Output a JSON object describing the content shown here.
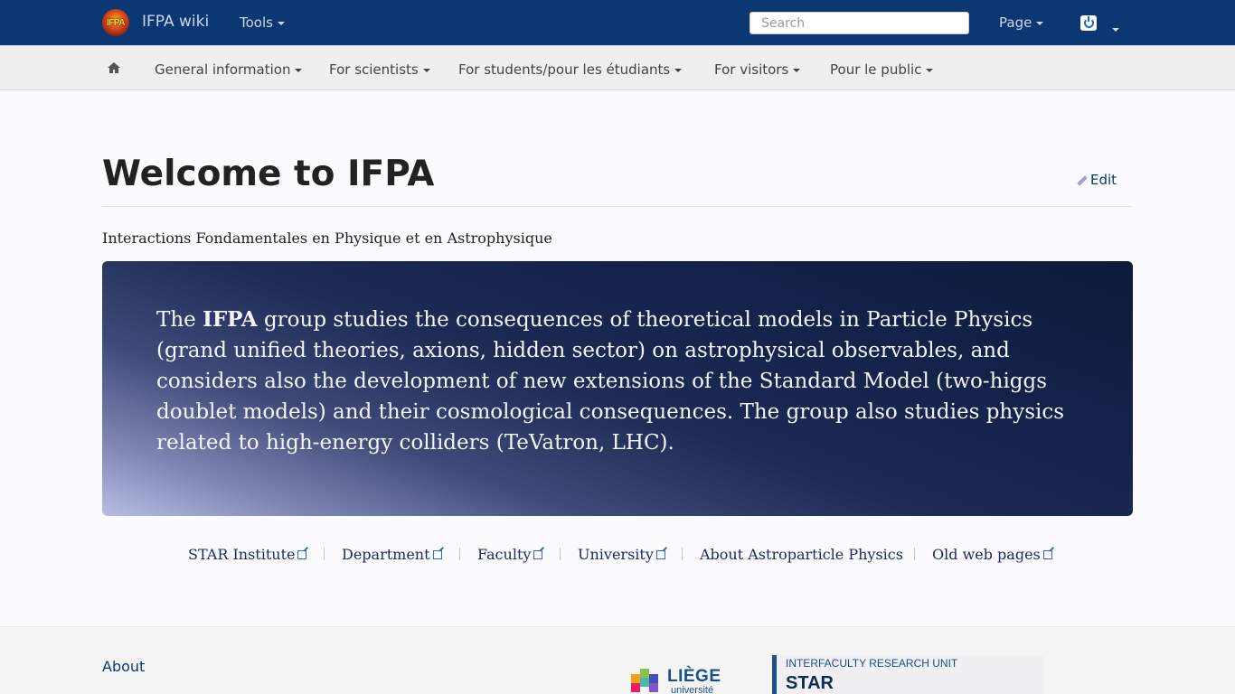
{
  "topbar": {
    "logo_text": "IFPA",
    "brand": "IFPA wiki",
    "tools_label": "Tools",
    "search_placeholder": "Search",
    "page_label": "Page",
    "colors": {
      "background": "#0b3772",
      "text": "#cdd7e6"
    },
    "icons": [
      "home-icon",
      "power-icon"
    ]
  },
  "subnav": {
    "items": [
      {
        "label": "General information"
      },
      {
        "label": "For scientists"
      },
      {
        "label": "For students/pour les étudiants"
      },
      {
        "label": "For visitors"
      },
      {
        "label": "Pour le public"
      }
    ]
  },
  "content": {
    "title": "Welcome to IFPA",
    "edit_label": "Edit",
    "subtitle": "Interactions Fondamentales en Physique et en Astrophysique",
    "hero": {
      "lead": "The ",
      "emphasis": "IFPA",
      "body": " group studies the consequences of theoretical models in Particle Physics (grand unified theories, axions, hidden sector) on astrophysical observables, and considers also the development of new extensions of the Standard Model (two-higgs doublet models) and their cosmological consequences. The group also studies physics related to high-energy colliders (TeVatron, LHC)."
    },
    "links": [
      {
        "label": "STAR Institute",
        "external": true
      },
      {
        "label": "Department",
        "external": true
      },
      {
        "label": "Faculty",
        "external": true
      },
      {
        "label": "University",
        "external": true
      },
      {
        "label": "About Astroparticle Physics",
        "external": false
      },
      {
        "label": "Old web pages",
        "external": true
      }
    ]
  },
  "footer": {
    "about_label": "About",
    "liege_logo": {
      "word": "LIÈGE",
      "sub": "université"
    },
    "star_logo": {
      "small": "INTERFACULTY RESEARCH UNIT",
      "big": "STAR"
    }
  }
}
